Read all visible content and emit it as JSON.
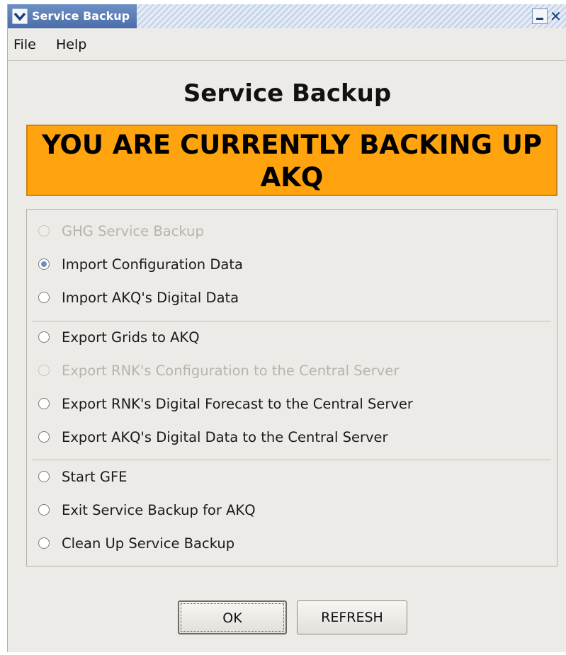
{
  "window": {
    "title": "Service Backup"
  },
  "menu": {
    "file": "File",
    "help": "Help"
  },
  "main": {
    "heading": "Service Backup",
    "banner_line1": "YOU ARE CURRENTLY BACKING UP",
    "banner_line2": "AKQ"
  },
  "options": [
    {
      "label": "GHG Service Backup",
      "enabled": false,
      "selected": false
    },
    {
      "label": "Import Configuration Data",
      "enabled": true,
      "selected": true
    },
    {
      "label": "Import AKQ's Digital Data",
      "enabled": true,
      "selected": false
    },
    {
      "label": "Export Grids to AKQ",
      "enabled": true,
      "selected": false
    },
    {
      "label": "Export RNK's Configuration to the Central Server",
      "enabled": false,
      "selected": false
    },
    {
      "label": "Export RNK's Digital Forecast to the Central Server",
      "enabled": true,
      "selected": false
    },
    {
      "label": "Export AKQ's Digital Data to the Central Server",
      "enabled": true,
      "selected": false
    },
    {
      "label": "Start GFE",
      "enabled": true,
      "selected": false
    },
    {
      "label": "Exit Service Backup for AKQ",
      "enabled": true,
      "selected": false
    },
    {
      "label": "Clean Up Service Backup",
      "enabled": true,
      "selected": false
    }
  ],
  "buttons": {
    "ok": "OK",
    "refresh": "REFRESH"
  },
  "colors": {
    "banner": "#ffa30f",
    "title_bar": "#4a6ea9",
    "selected_radio": "#6a8fc5"
  },
  "icons": {
    "window_menu": "chevron-down-icon",
    "minimize": "minimize-icon",
    "close": "close-icon"
  }
}
